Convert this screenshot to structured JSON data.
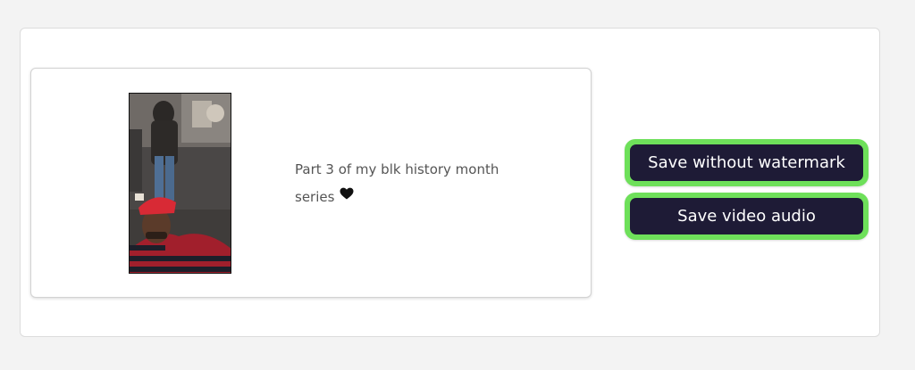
{
  "video": {
    "caption_line1": "Part 3 of my blk history month",
    "caption_line2": "series",
    "caption_emoji": "black-heart-icon"
  },
  "actions": {
    "save_without_watermark_label": "Save without watermark",
    "save_video_audio_label": "Save video audio"
  },
  "colors": {
    "page_background": "#f3f3f3",
    "button_fill": "#1e1b36",
    "button_outline": "#6ee05a",
    "caption_text": "#555555"
  }
}
